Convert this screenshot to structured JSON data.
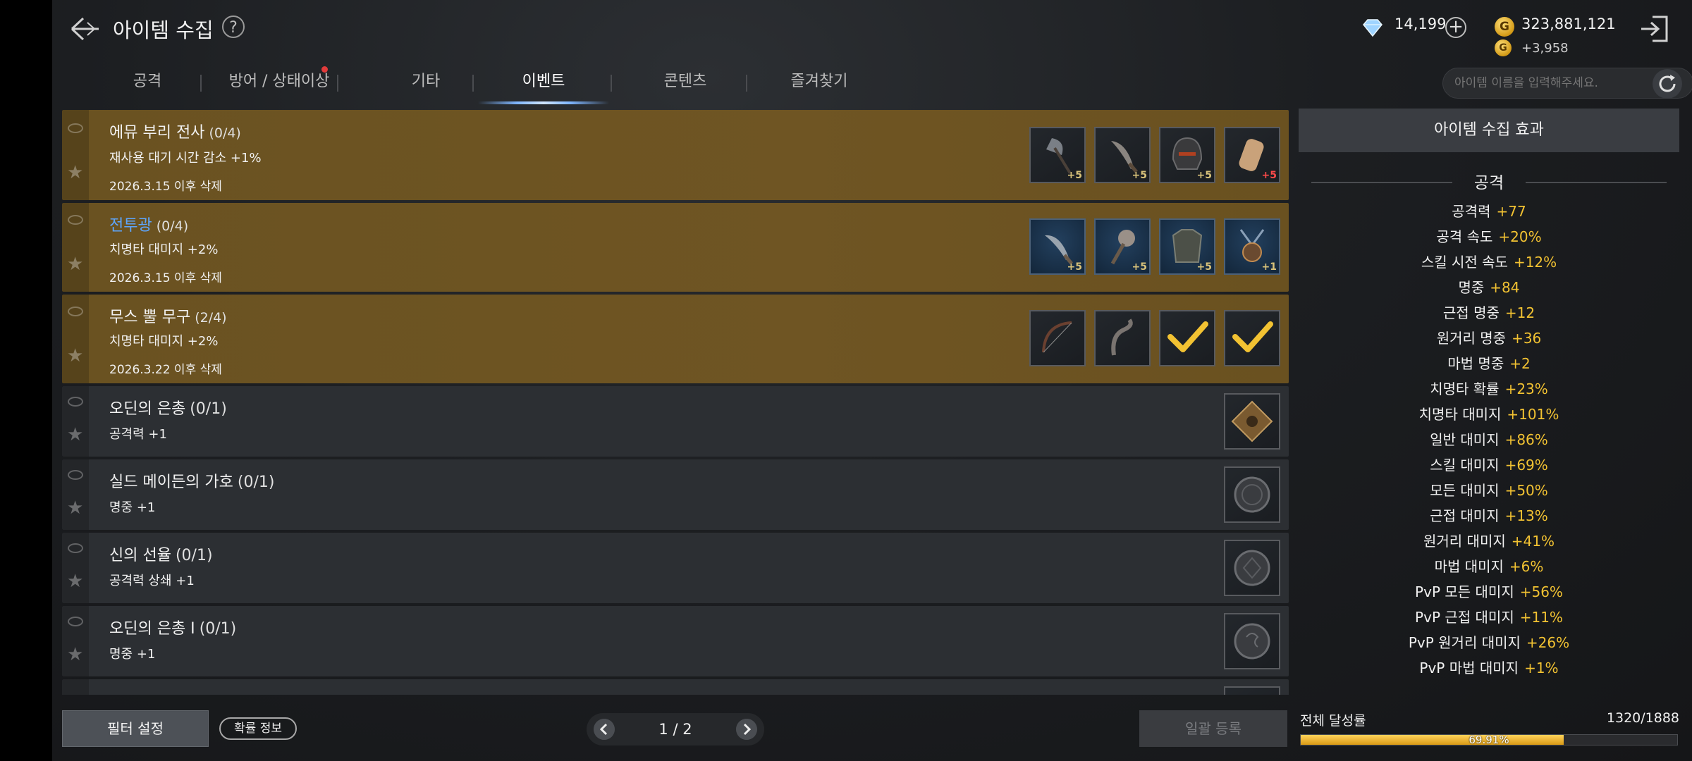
{
  "header": {
    "title": "아이템 수집",
    "help_label": "?",
    "diamonds": "14,199",
    "gold": "323,881,121",
    "gold_delta": "+3,958",
    "coin_glyph": "G"
  },
  "tabs": [
    {
      "label": "공격",
      "active": false
    },
    {
      "label": "방어 / 상태이상",
      "active": false,
      "badge": true
    },
    {
      "label": "기타",
      "active": false
    },
    {
      "label": "이벤트",
      "active": true
    },
    {
      "label": "콘텐츠",
      "active": false
    },
    {
      "label": "즐겨찾기",
      "active": false
    }
  ],
  "search": {
    "placeholder": "아이템 이름을 입력해주세요."
  },
  "collections": [
    {
      "name": "에뮤 부리 전사",
      "count": "(0/4)",
      "effect": "재사용 대기 시간 감소 +1%",
      "date": "2026.3.15 이후 삭제",
      "style": "gold",
      "items": [
        {
          "icon": "axe-icon",
          "level": "+5"
        },
        {
          "icon": "dagger-icon",
          "level": "+5"
        },
        {
          "icon": "helmet-icon",
          "level": "+5"
        },
        {
          "icon": "gauntlet-icon",
          "level": "+5",
          "level_color": "red"
        }
      ]
    },
    {
      "name": "전투광",
      "count": "(0/4)",
      "effect": "치명타 대미지 +2%",
      "date": "2026.3.15 이후 삭제",
      "style": "gold",
      "name_color": "blue",
      "items": [
        {
          "icon": "dagger-icon",
          "level": "+5",
          "blue": true
        },
        {
          "icon": "mace-icon",
          "level": "+5",
          "blue": true
        },
        {
          "icon": "armor-icon",
          "level": "+5",
          "blue": true
        },
        {
          "icon": "amulet-icon",
          "level": "+1",
          "blue": true
        }
      ]
    },
    {
      "name": "무스 뿔 무구",
      "count": "(2/4)",
      "effect": "치명타 대미지 +2%",
      "date": "2026.3.22 이후 삭제",
      "style": "gold",
      "items": [
        {
          "icon": "bow-icon",
          "level": ""
        },
        {
          "icon": "horn-icon",
          "level": ""
        },
        {
          "icon": "checkmark-icon",
          "level": "",
          "done": true
        },
        {
          "icon": "checkmark-icon",
          "level": "",
          "done": true
        }
      ]
    },
    {
      "name": "오딘의 은총",
      "count": "(0/1)",
      "effect": "공격력 +1",
      "date": "",
      "style": "gray",
      "items": [
        {
          "icon": "rune-diamond-icon",
          "level": ""
        }
      ]
    },
    {
      "name": "실드 메이든의 가호",
      "count": "(0/1)",
      "effect": "명중 +1",
      "date": "",
      "style": "gray",
      "items": [
        {
          "icon": "coin-icon",
          "level": ""
        }
      ]
    },
    {
      "name": "신의 선율",
      "count": "(0/1)",
      "effect": "공격력 상쇄 +1",
      "date": "",
      "style": "gray",
      "items": [
        {
          "icon": "coin-icon",
          "level": ""
        }
      ]
    },
    {
      "name": "오딘의 은총 I",
      "count": "(0/1)",
      "effect": "명중 +1",
      "date": "",
      "style": "gray",
      "items": [
        {
          "icon": "coin-icon",
          "level": ""
        }
      ]
    }
  ],
  "panel": {
    "title": "아이템 수집 효과",
    "section": "공격",
    "stats": [
      {
        "label": "공격력",
        "value": "+77"
      },
      {
        "label": "공격 속도",
        "value": "+20%"
      },
      {
        "label": "스킬 시전 속도",
        "value": "+12%"
      },
      {
        "label": "명중",
        "value": "+84"
      },
      {
        "label": "근접 명중",
        "value": "+12"
      },
      {
        "label": "원거리 명중",
        "value": "+36"
      },
      {
        "label": "마법 명중",
        "value": "+2"
      },
      {
        "label": "치명타 확률",
        "value": "+23%"
      },
      {
        "label": "치명타 대미지",
        "value": "+101%"
      },
      {
        "label": "일반 대미지",
        "value": "+86%"
      },
      {
        "label": "스킬 대미지",
        "value": "+69%"
      },
      {
        "label": "모든 대미지",
        "value": "+50%"
      },
      {
        "label": "근접 대미지",
        "value": "+13%"
      },
      {
        "label": "원거리 대미지",
        "value": "+41%"
      },
      {
        "label": "마법 대미지",
        "value": "+6%"
      },
      {
        "label": "PvP 모든 대미지",
        "value": "+56%"
      },
      {
        "label": "PvP 근접 대미지",
        "value": "+11%"
      },
      {
        "label": "PvP 원거리 대미지",
        "value": "+26%"
      },
      {
        "label": "PvP 마법 대미지",
        "value": "+1%"
      }
    ]
  },
  "footer": {
    "filter_label": "필터 설정",
    "prob_label": "확률 정보",
    "page": "1 / 2",
    "bulk_label": "일괄 등록",
    "progress_label": "전체 달성률",
    "progress_count": "1320/1888",
    "progress_text": "69.91%",
    "progress_value": 0.6991
  },
  "colors": {
    "accent_gold": "#f2c232",
    "row_gold": "#6f5523",
    "blue_name": "#5da6ff"
  }
}
